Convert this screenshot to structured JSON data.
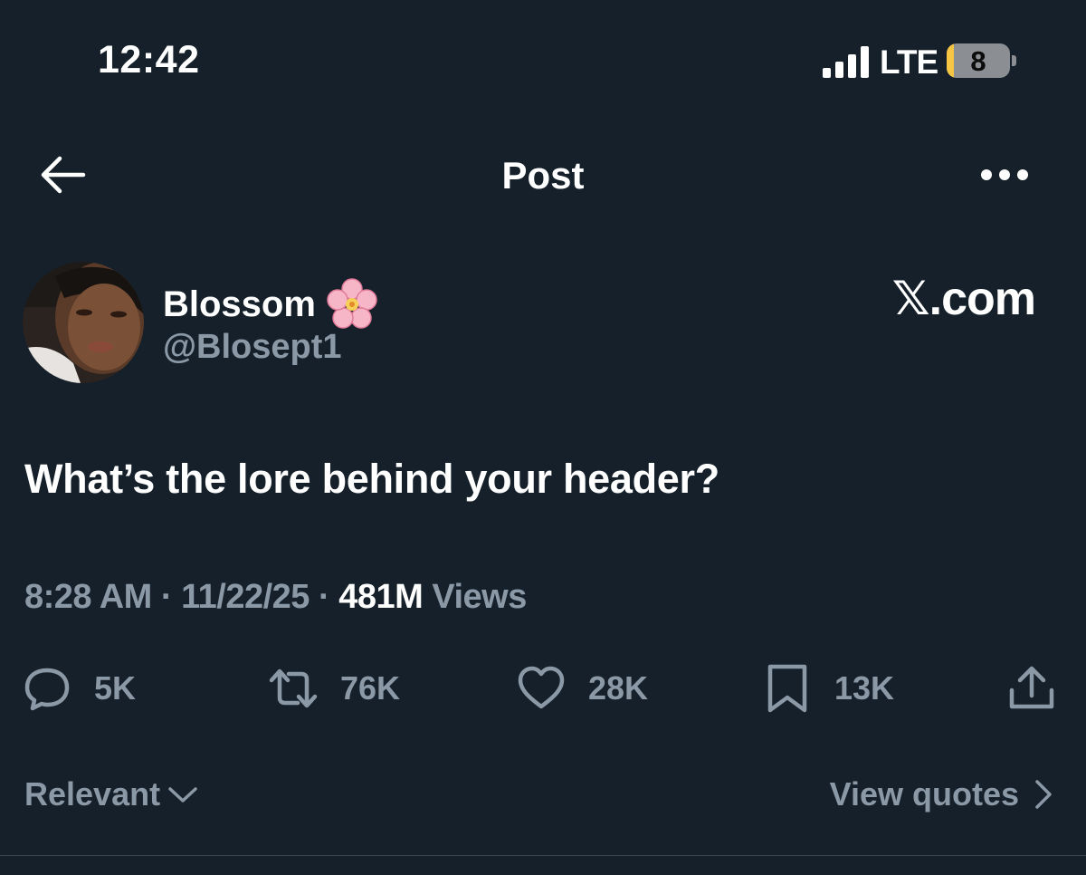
{
  "status_bar": {
    "time": "12:42",
    "network": "LTE",
    "battery": "8"
  },
  "header": {
    "title": "Post"
  },
  "author": {
    "display_name": "Blossom",
    "handle": "@Blosept1",
    "emoji_icon": "cherry-blossom-icon"
  },
  "watermark": "𝕏.com",
  "post": {
    "text": "What’s the lore behind your header?"
  },
  "meta": {
    "time": "8:28 AM",
    "sep1": " · ",
    "date": "11/22/25",
    "sep2": " · ",
    "views_count": "481M",
    "views_label": " Views"
  },
  "actions": {
    "replies": {
      "count": "5K",
      "icon": "reply-icon"
    },
    "reposts": {
      "count": "76K",
      "icon": "repost-icon"
    },
    "likes": {
      "count": "28K",
      "icon": "heart-icon"
    },
    "bookmarks": {
      "count": "13K",
      "icon": "bookmark-icon"
    },
    "share": {
      "icon": "share-icon"
    }
  },
  "footer": {
    "sort_label": "Relevant",
    "quotes_label": "View quotes"
  },
  "colors": {
    "background": "#15202b",
    "primary_text": "#ffffff",
    "secondary_text": "#8b98a5",
    "battery_fill": "#f6c544"
  }
}
